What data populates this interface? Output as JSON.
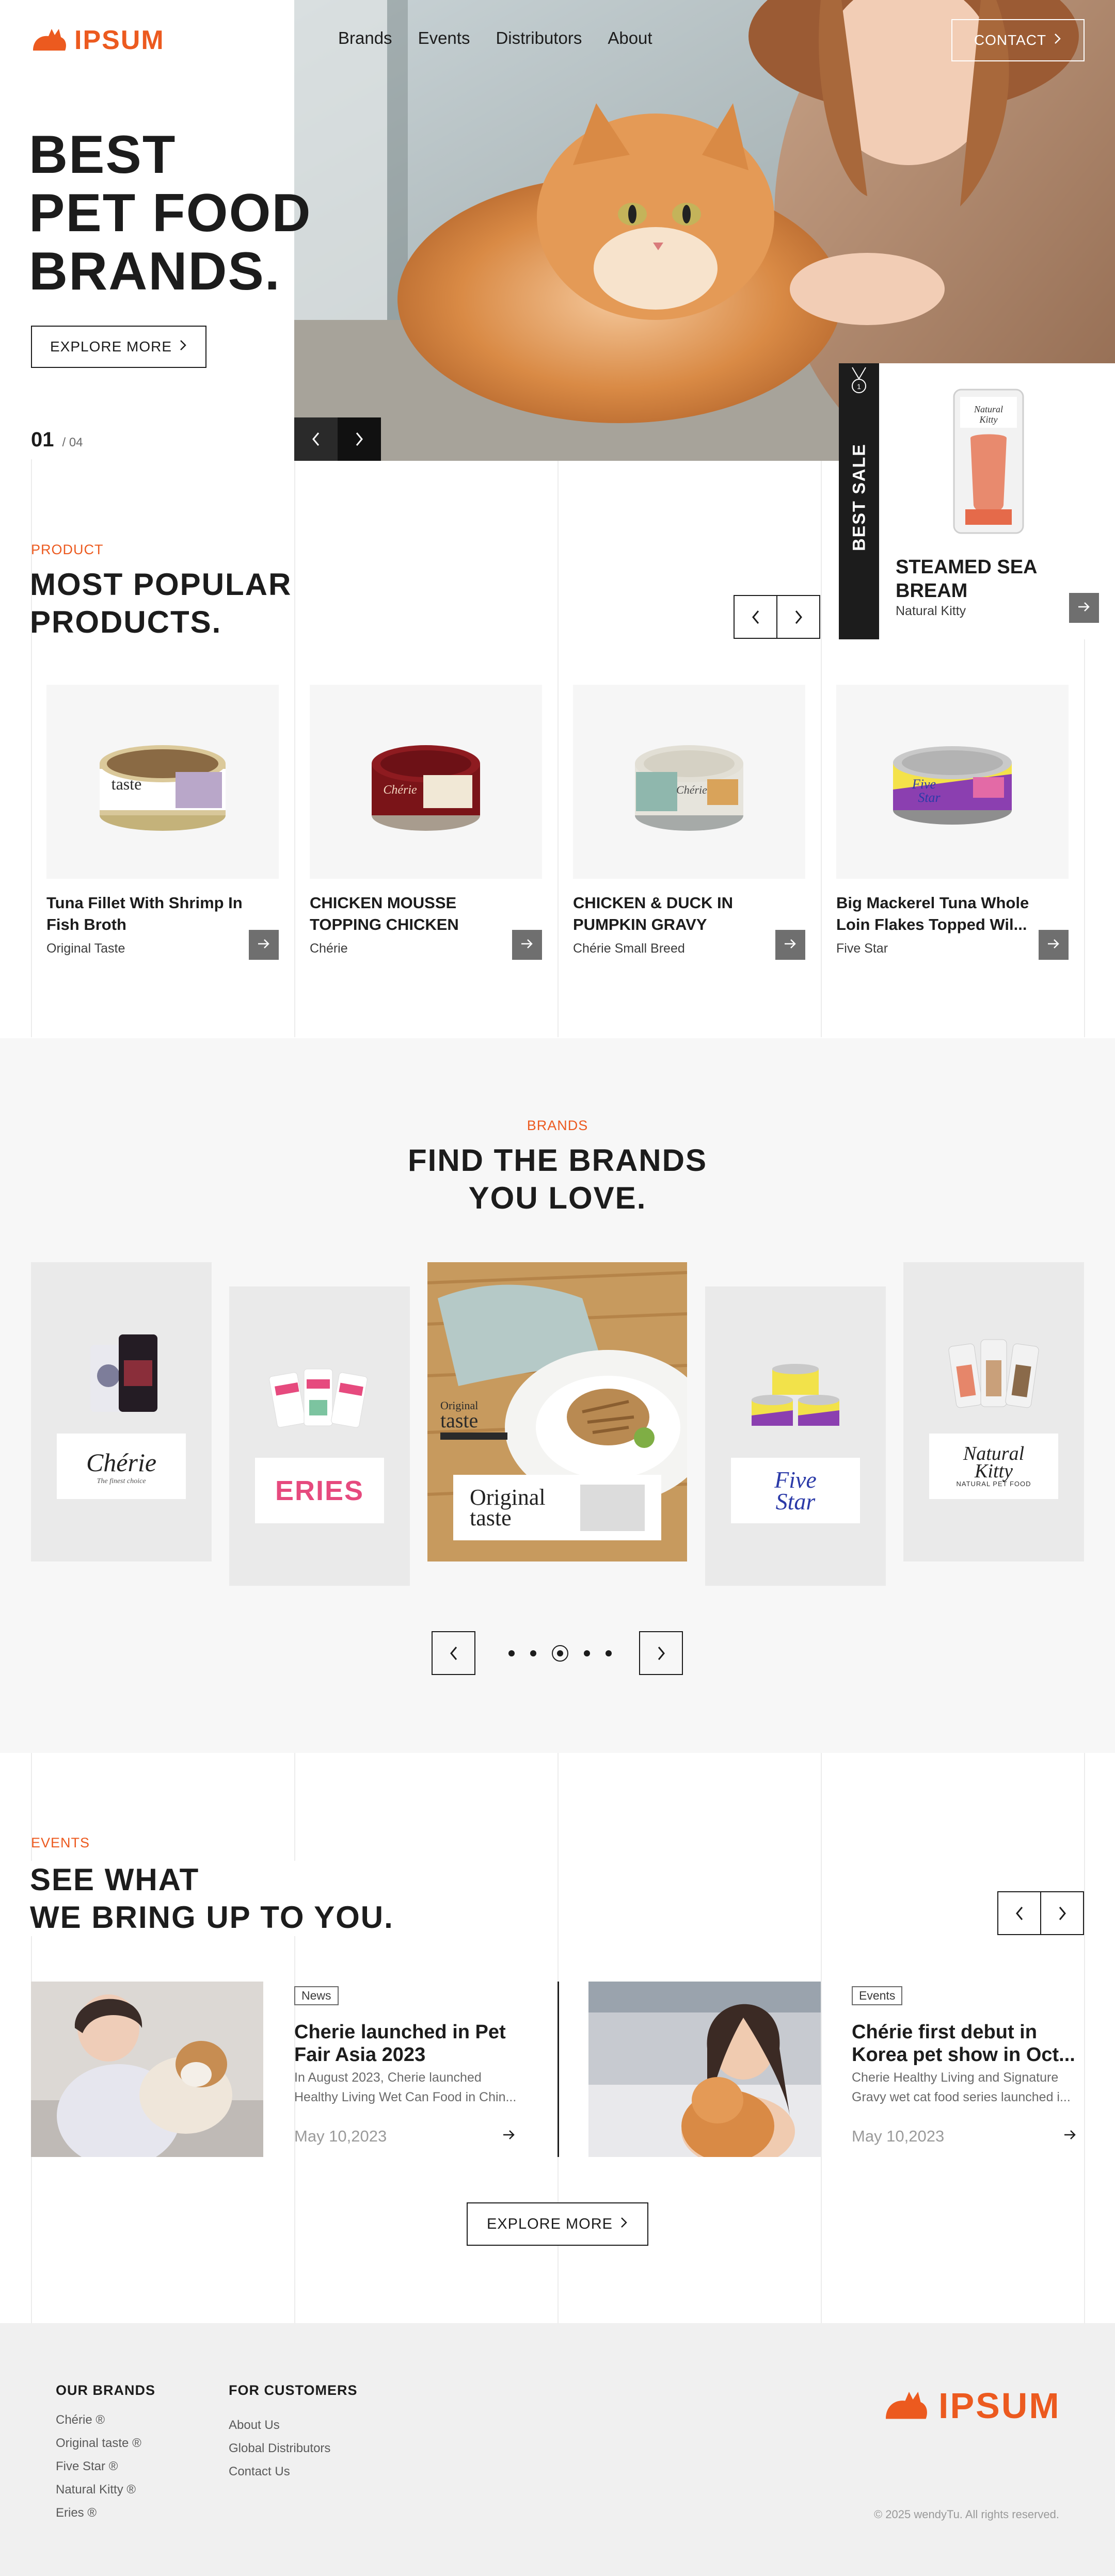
{
  "colors": {
    "accent": "#ec5a1f",
    "dark": "#1c1c1c",
    "grey_bg": "#f7f7f7",
    "footer_bg": "#f0f0f0"
  },
  "header": {
    "logo": "IPSUM",
    "nav": [
      "Brands",
      "Events",
      "Distributors",
      "About"
    ],
    "contact_label": "CONTACT"
  },
  "hero": {
    "title_lines": [
      "BEST",
      "PET FOOD",
      "BRANDS."
    ],
    "explore_label": "EXPLORE MORE",
    "slide_current": "01",
    "slide_total": "/ 04"
  },
  "best_sale": {
    "badge": "BEST SALE",
    "name": "STEAMED SEA BREAM",
    "brand": "Natural Kitty"
  },
  "products": {
    "eyebrow": "PRODUCT",
    "title_lines": [
      "MOST POPULAR",
      "PRODUCTS."
    ],
    "items": [
      {
        "name": "Tuna Fillet With Shrimp In Fish Broth",
        "brand": "Original Taste"
      },
      {
        "name": "CHICKEN MOUSSE TOPPING CHICKEN",
        "brand": "Chérie"
      },
      {
        "name": "CHICKEN & DUCK IN PUMPKIN GRAVY",
        "brand": "Chérie Small Breed"
      },
      {
        "name": "Big Mackerel Tuna Whole Loin Flakes Topped Wil...",
        "brand": "Five Star"
      }
    ]
  },
  "brands": {
    "eyebrow": "BRANDS",
    "title_lines": [
      "FIND THE BRANDS",
      "YOU LOVE."
    ],
    "logos": [
      "Chérie",
      "ERIES",
      "Original taste",
      "Five Star",
      "Natural Kitty"
    ],
    "logo_subtitles": [
      "The finest choice",
      "",
      "",
      "",
      "NATURAL PET FOOD"
    ]
  },
  "events": {
    "eyebrow": "EVENTS",
    "title_lines": [
      "SEE WHAT",
      "WE BRING UP TO YOU."
    ],
    "items": [
      {
        "tag": "News",
        "title": "Cherie launched in Pet Fair Asia 2023",
        "body": "In August 2023, Cherie launched Healthy Living Wet Can Food in Chin...",
        "date": "May 10,2023"
      },
      {
        "tag": "Events",
        "title": "Chérie first debut in Korea pet show in Oct...",
        "body": "Cherie Healthy Living and Signature Gravy wet cat food series launched i...",
        "date": "May 10,2023"
      }
    ],
    "explore_label": "EXPLORE MORE"
  },
  "footer": {
    "brands_heading": "OUR BRANDS",
    "brands": [
      "Chérie ®",
      "Original taste ®",
      "Five Star ®",
      "Natural Kitty ®",
      "Eries ®"
    ],
    "customers_heading": "FOR CUSTOMERS",
    "customers": [
      "About Us",
      "Global Distributors",
      "Contact Us"
    ],
    "logo": "IPSUM",
    "copyright": "© 2025  wendyTu. All rights reserved."
  }
}
